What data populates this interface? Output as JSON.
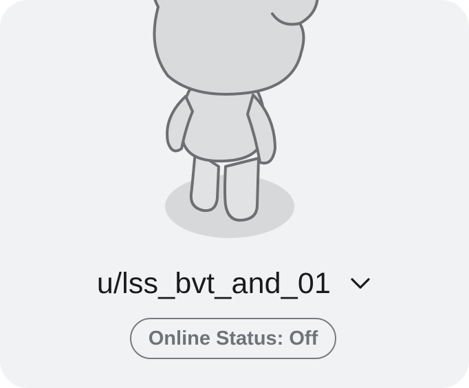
{
  "profile": {
    "username": "u/lss_bvt_and_01",
    "avatar_icon": "default-snoo-avatar",
    "dropdown_icon": "chevron-down-icon"
  },
  "status": {
    "label": "Online Status: Off"
  },
  "colors": {
    "card_background": "#f1f2f4",
    "text_primary": "#1a1a1b",
    "pill_border": "#777a7f",
    "pill_text": "#6f7378"
  }
}
